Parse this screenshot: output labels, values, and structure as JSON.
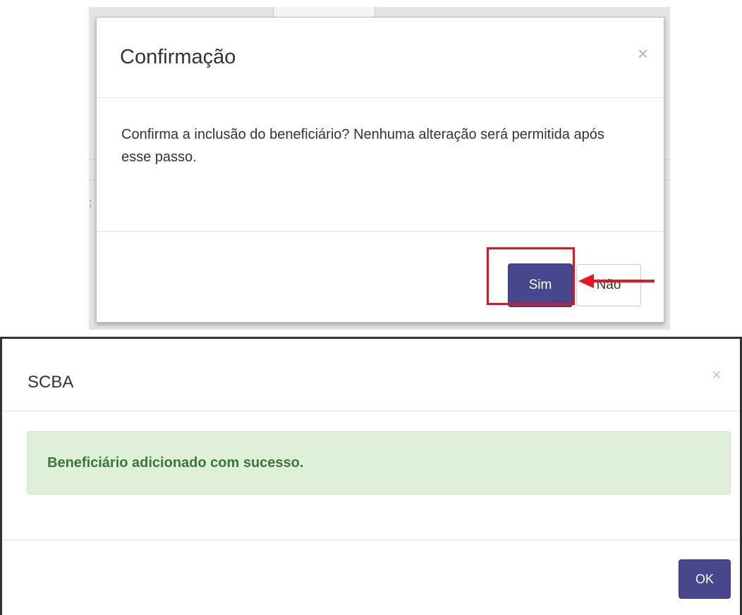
{
  "confirm_dialog": {
    "title": "Confirmação",
    "close_symbol": "×",
    "message": "Confirma a inclusão do beneficiário? Nenhuma alteração será permitida após esse passo.",
    "buttons": {
      "yes_label": "Sim",
      "no_label": "Não"
    },
    "accent_color": "#46478d",
    "annotation_color": "#e8131b"
  },
  "success_dialog": {
    "title": "SCBA",
    "close_symbol": "×",
    "alert_message": "Beneficiário adicionado com sucesso.",
    "ok_label": "OK",
    "alert_bg_color": "#dff0d8",
    "alert_text_color": "#3c763d"
  }
}
